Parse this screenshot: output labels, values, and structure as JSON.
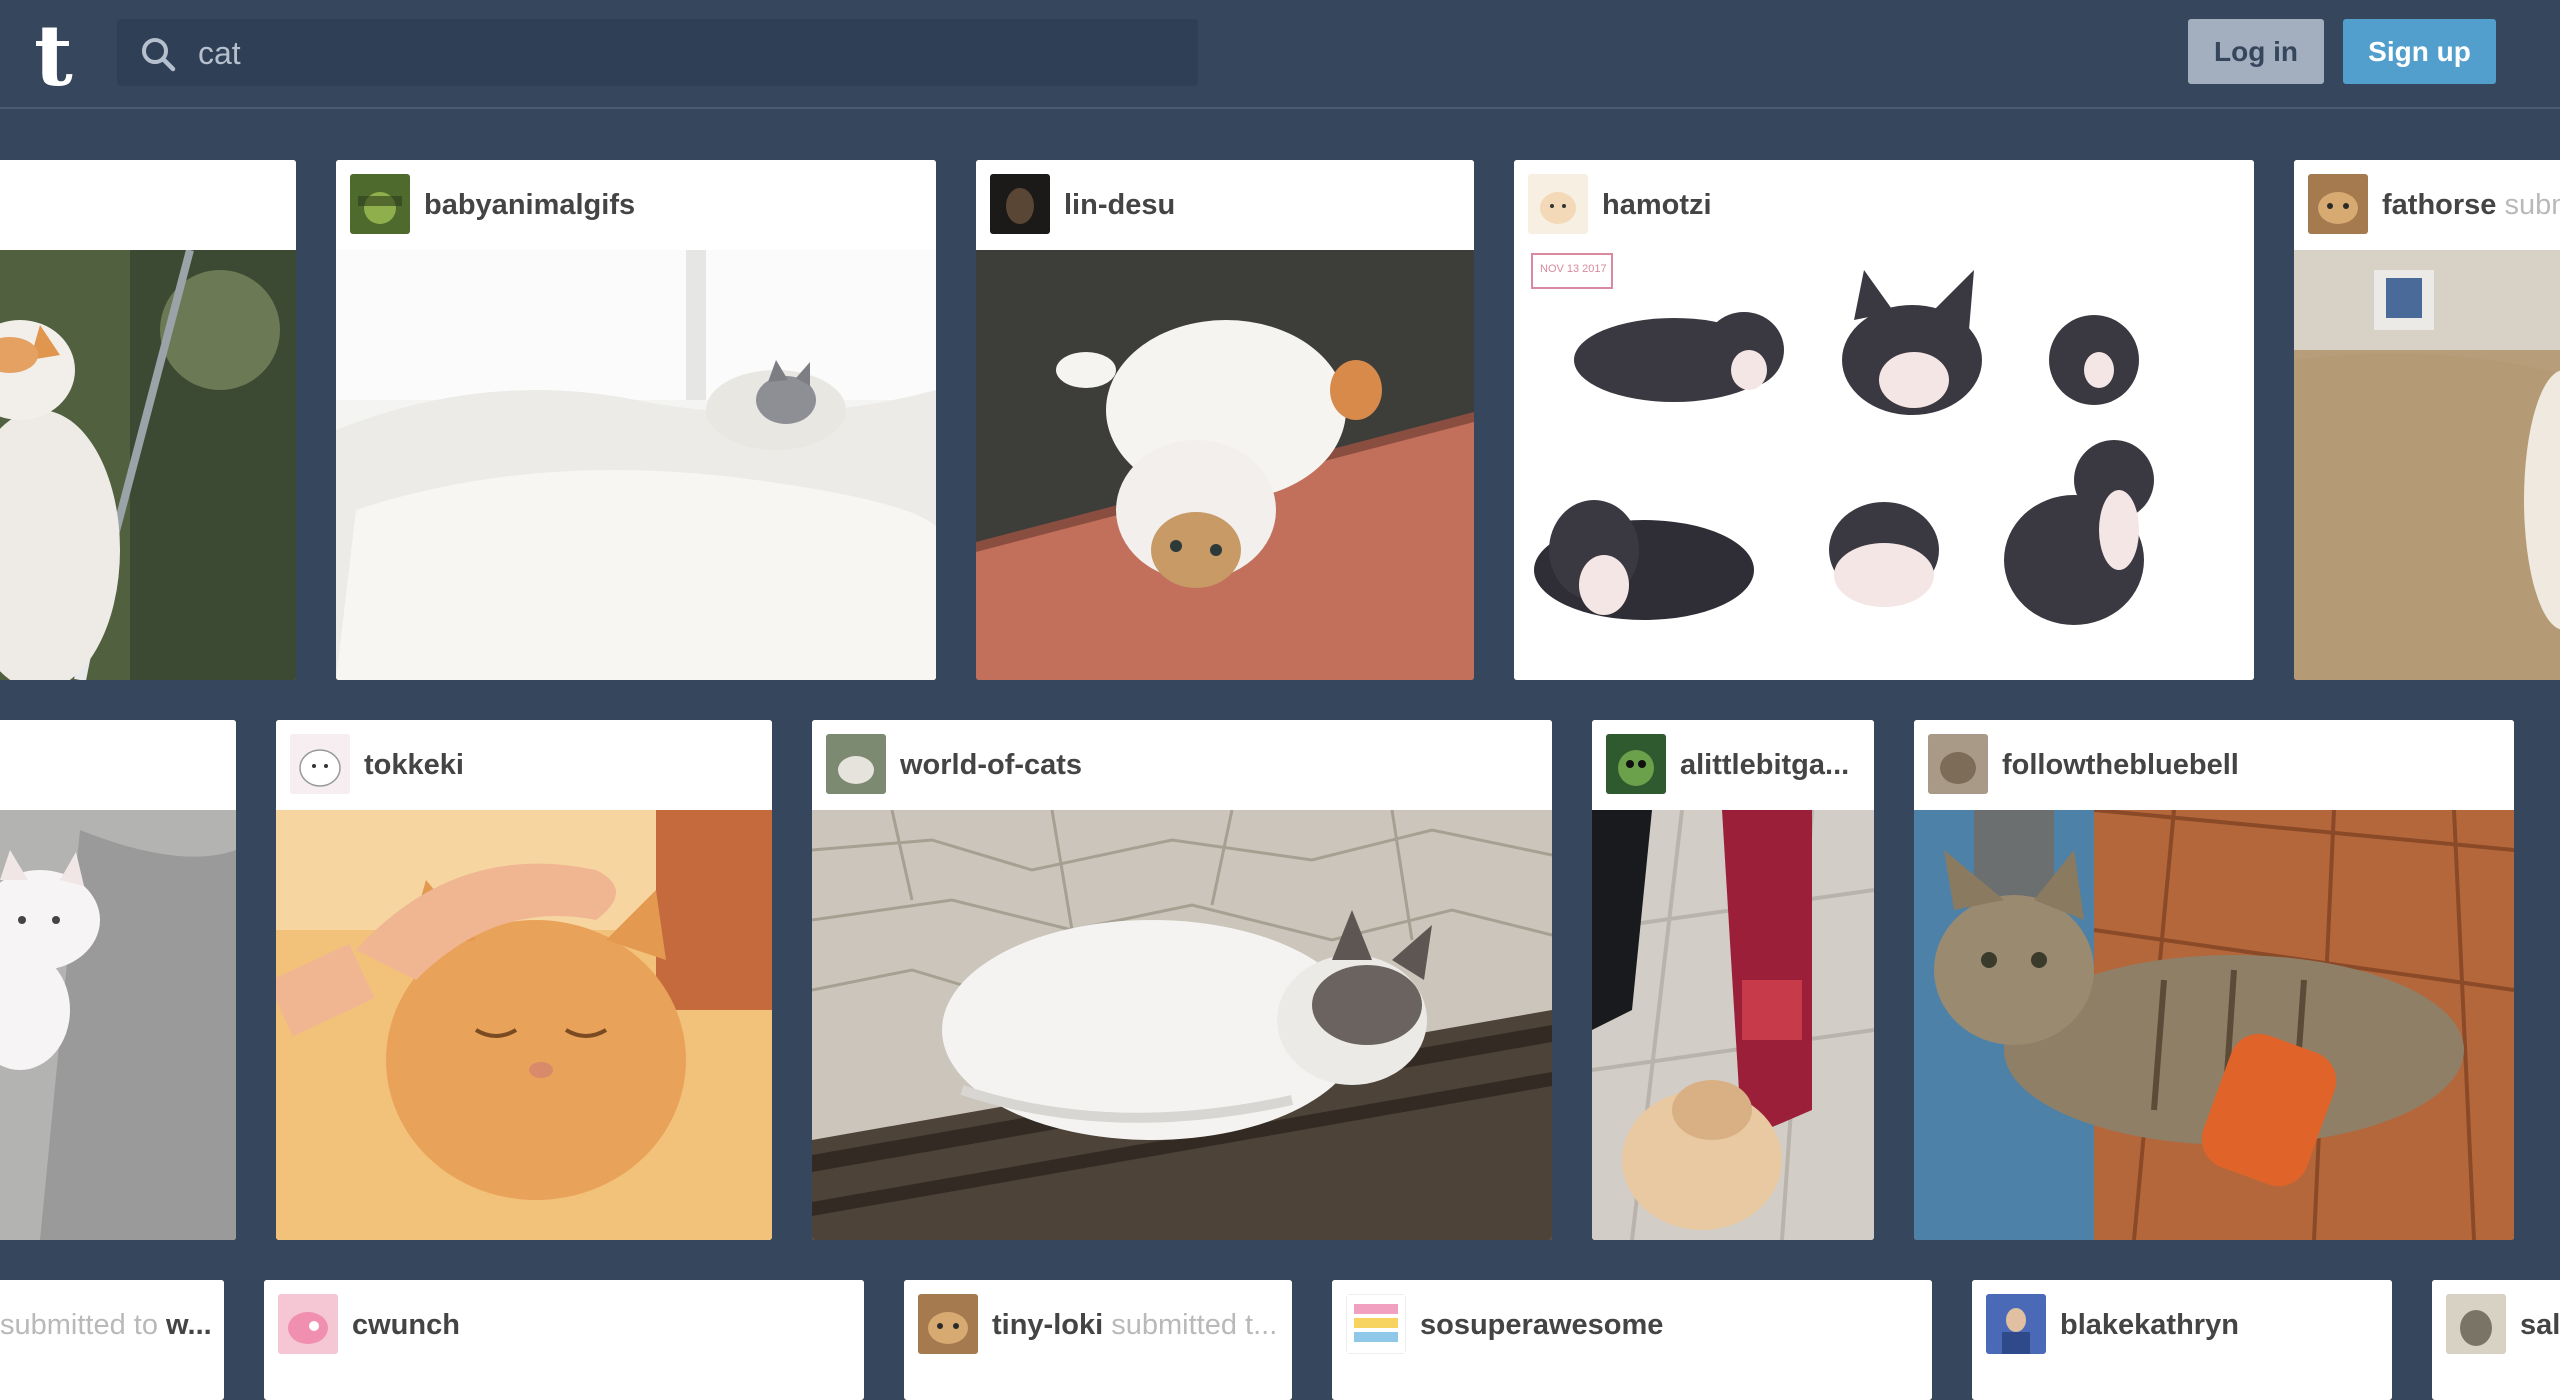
{
  "header": {
    "logo": "t",
    "search": {
      "value": "cat"
    },
    "login_label": "Log in",
    "signup_label": "Sign up"
  },
  "posts": {
    "row1": [
      {
        "blog": ""
      },
      {
        "blog": "babyanimalgifs"
      },
      {
        "blog": "lin-desu"
      },
      {
        "blog": "hamotzi"
      },
      {
        "blog": "fathorse",
        "submitted": "submitted to"
      }
    ],
    "row2": [
      {
        "blog": ""
      },
      {
        "blog": "tokkeki"
      },
      {
        "blog": "world-of-cats"
      },
      {
        "blog": "alittlebitga..."
      },
      {
        "blog": "followthebluebell"
      }
    ],
    "row3": [
      {
        "submitted": "submitted to",
        "target": "w..."
      },
      {
        "blog": "cwunch"
      },
      {
        "blog": "tiny-loki",
        "submitted": "submitted t..."
      },
      {
        "blog": "sosuperawesome"
      },
      {
        "blog": "blakekathryn"
      },
      {
        "blog": "sal"
      }
    ]
  },
  "art": {
    "hamotzi_stamp": "NOV 13 2017"
  },
  "colors": {
    "background": "#36465d",
    "login_bg": "#a3afbe",
    "signup_bg": "#529ecc",
    "search_bg": "#2f3f56"
  }
}
